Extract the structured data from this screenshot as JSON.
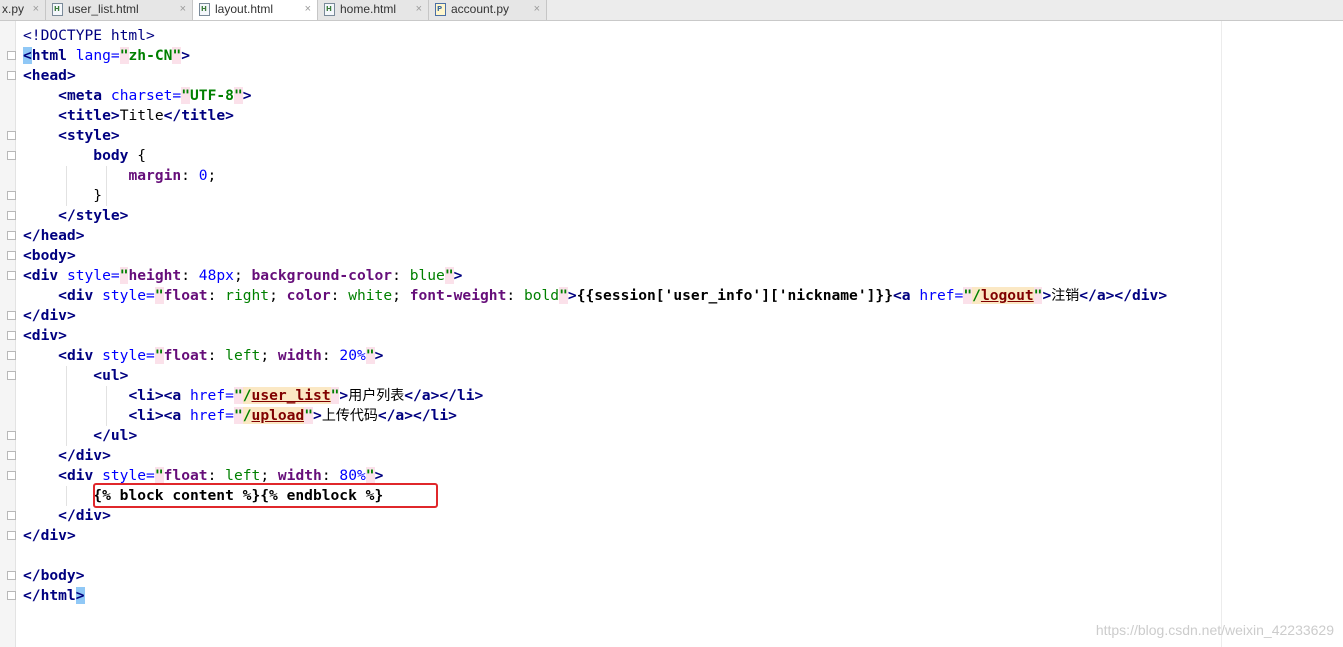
{
  "tabs": [
    {
      "label": "x.py",
      "icon": "python-file-icon",
      "active": false
    },
    {
      "label": "user_list.html",
      "icon": "html-file-icon",
      "active": false
    },
    {
      "label": "layout.html",
      "icon": "html-file-icon",
      "active": true
    },
    {
      "label": "home.html",
      "icon": "html-file-icon",
      "active": false
    },
    {
      "label": "account.py",
      "icon": "python-file-icon",
      "active": false
    }
  ],
  "tab_close_glyph": "×",
  "code": {
    "l1_doctype": "<!DOCTYPE html>",
    "l2_tag": "html",
    "l2_attr": "lang",
    "l2_val": "zh-CN",
    "l3_tag": "head",
    "l4_tag": "meta",
    "l4_attr": "charset",
    "l4_val": "UTF-8",
    "l5_tag": "title",
    "l5_text": "Title",
    "l6_tag": "style",
    "l7_selector": "body",
    "l8_prop": "margin",
    "l8_val": "0",
    "l11_tag": "head",
    "l12_tag": "body",
    "l13_tag": "div",
    "l13_attr": "style",
    "l13_p1": "height",
    "l13_v1": "48px",
    "l13_p2": "background-color",
    "l13_v2": "blue",
    "l14_tag": "div",
    "l14_attr": "style",
    "l14_p1": "float",
    "l14_v1": "right",
    "l14_p2": "color",
    "l14_v2": "white",
    "l14_p3": "font-weight",
    "l14_v3": "bold",
    "l14_expr": "{{session['user_info']['nickname']}}",
    "l14_a": "a",
    "l14_href": "href",
    "l14_link": "logout",
    "l14_text": "注销",
    "l15_tag": "div",
    "l16_tag": "div",
    "l17_tag": "div",
    "l17_attr": "style",
    "l17_p1": "float",
    "l17_v1": "left",
    "l17_p2": "width",
    "l17_v2": "20",
    "l18_tag": "ul",
    "l19_li": "li",
    "l19_a": "a",
    "l19_href": "href",
    "l19_link": "user_list",
    "l19_text": "用户列表",
    "l20_li": "li",
    "l20_a": "a",
    "l20_href": "href",
    "l20_link": "upload",
    "l20_text": "上传代码",
    "l21_tag": "ul",
    "l22_tag": "div",
    "l23_tag": "div",
    "l23_attr": "style",
    "l23_p1": "float",
    "l23_v1": "left",
    "l23_p2": "width",
    "l23_v2": "80",
    "l24_template": "{% block content %}{% endblock %}",
    "l25_tag": "div",
    "l26_tag": "div",
    "l28_tag": "body",
    "l29_tag": "html"
  },
  "watermark": "https://blog.csdn.net/weixin_42233629",
  "colors": {
    "highlight_box": "#e0272b",
    "tag": "#000080",
    "attr": "#0000ff",
    "string": "#008000"
  }
}
